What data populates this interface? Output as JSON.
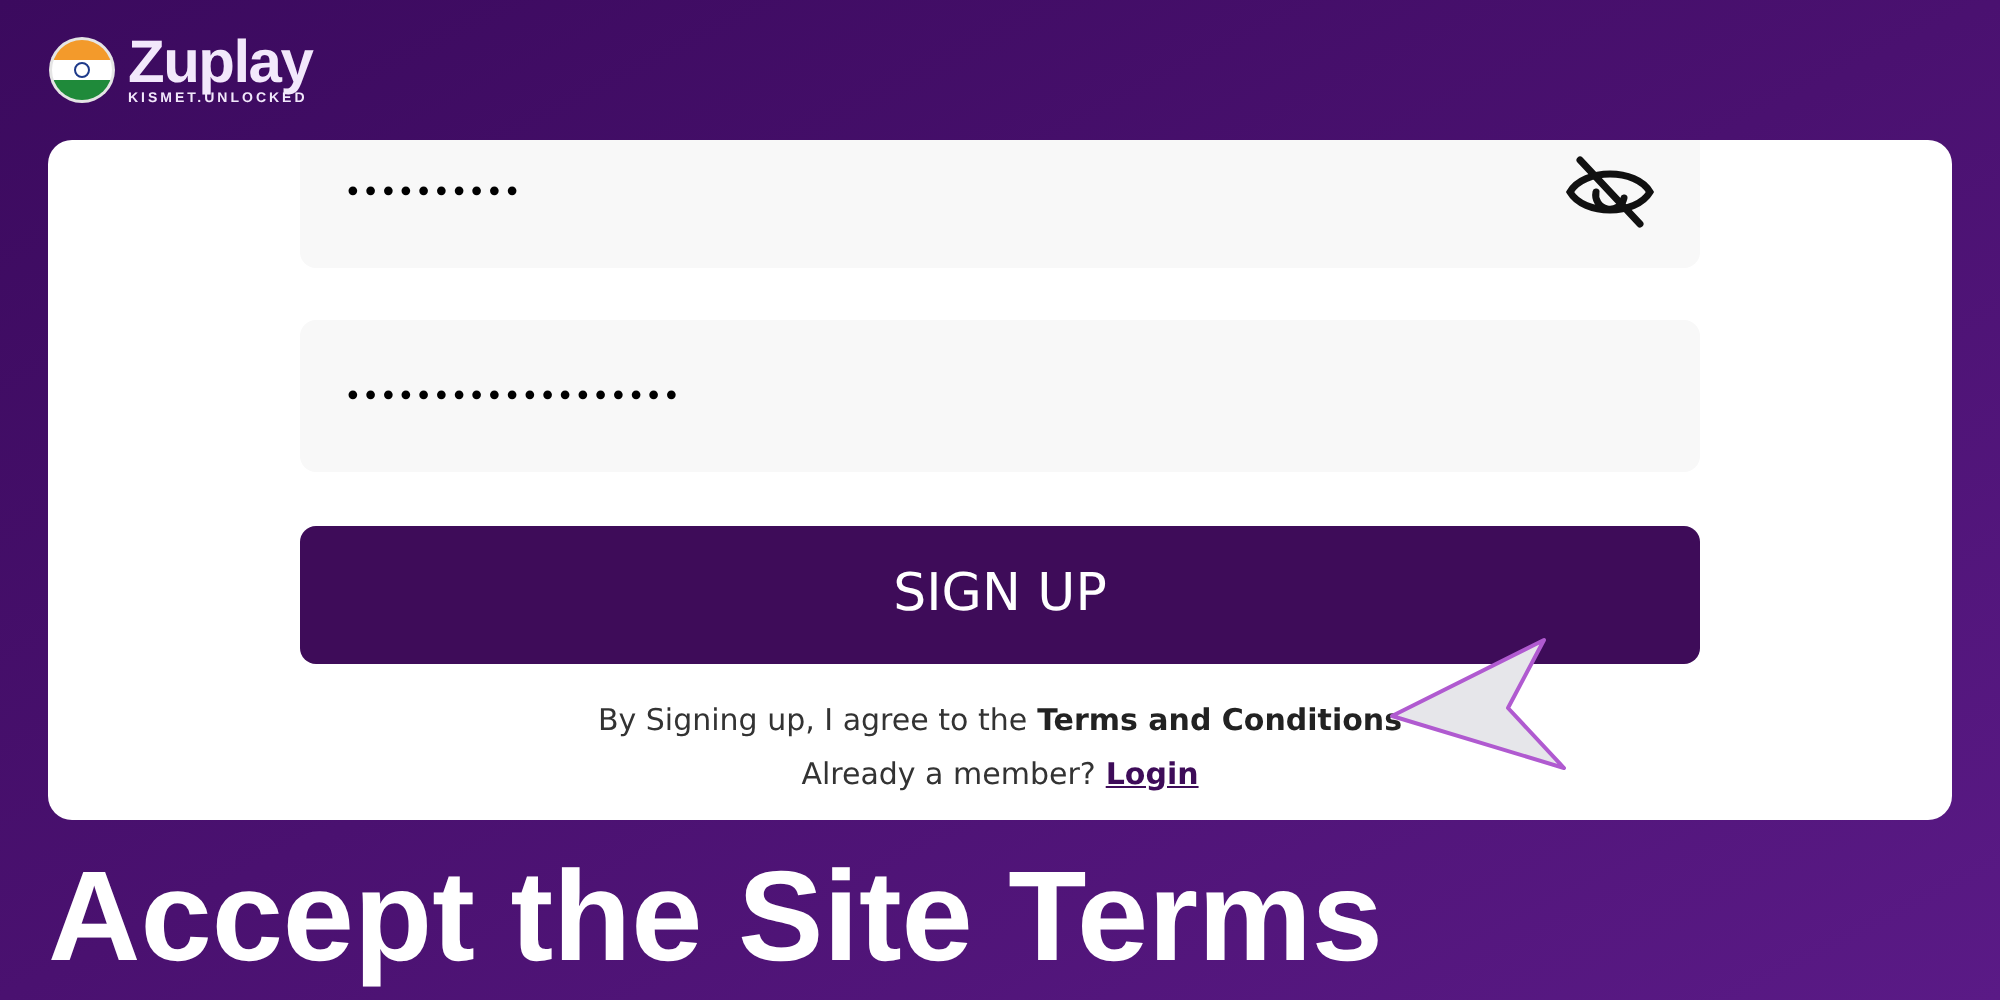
{
  "logo": {
    "name": "Zuplay",
    "tagline": "KISMET.UNLOCKED"
  },
  "form": {
    "fields": [
      {
        "value": "••••••••••",
        "visibility_toggle": true
      },
      {
        "value": "•••••••••••••••••••",
        "visibility_toggle": false
      }
    ],
    "submit": "SIGN UP",
    "agreement": {
      "text": "By Signing up, I agree to the",
      "link": "Terms and Conditions"
    },
    "member": {
      "text": "Already a member?",
      "link": "Login"
    }
  },
  "caption": "Accept the Site Terms"
}
